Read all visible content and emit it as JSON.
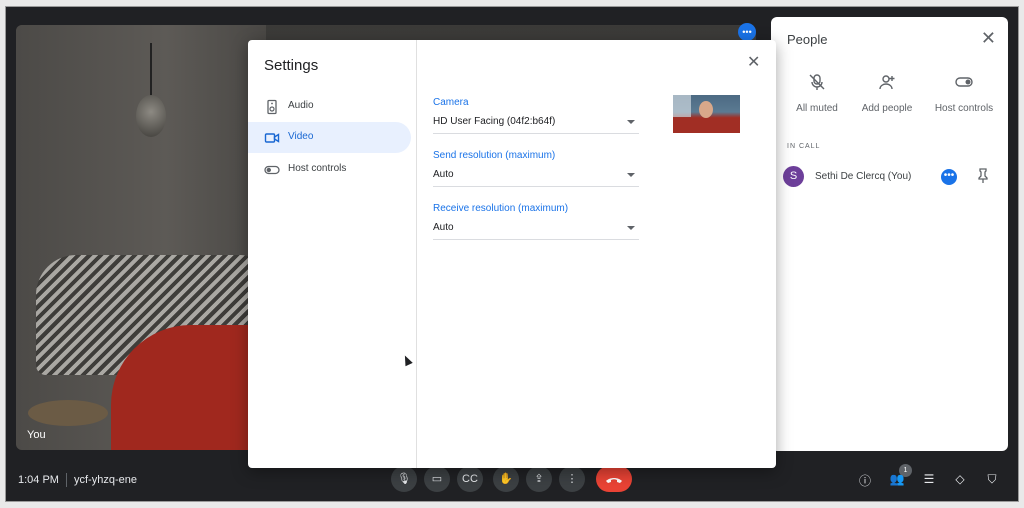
{
  "stage": {
    "self_tag": "You"
  },
  "people_panel": {
    "title": "People",
    "actions": [
      {
        "label": "All muted",
        "icon": "mic-off-icon"
      },
      {
        "label": "Add people",
        "icon": "add-person-icon"
      },
      {
        "label": "Host controls",
        "icon": "toggle-icon"
      }
    ],
    "section_label": "IN CALL",
    "participant": {
      "initial": "S",
      "name": "Sethi De Clercq (You)",
      "avatar_color": "#6d3f9a"
    }
  },
  "bottom_bar": {
    "time": "1:04 PM",
    "meeting_code": "ycf-yhzq-ene",
    "controls": [
      "mic-icon",
      "camera-icon",
      "captions-icon",
      "raise-hand-icon",
      "present-icon",
      "more-options-icon",
      "end-call-icon"
    ],
    "cc_label": "CC",
    "people_count": "1",
    "right_icons": [
      "info-icon",
      "people-icon",
      "chat-icon",
      "activities-icon",
      "shield-icon"
    ],
    "end_call_color": "#ea4335"
  },
  "settings": {
    "title": "Settings",
    "nav": [
      {
        "label": "Audio",
        "icon": "speaker-icon"
      },
      {
        "label": "Video",
        "icon": "video-camera-icon",
        "active": true
      },
      {
        "label": "Host controls",
        "icon": "toggle-icon"
      }
    ],
    "fields": [
      {
        "label": "Camera",
        "value": "HD User Facing (04f2:b64f)"
      },
      {
        "label": "Send resolution (maximum)",
        "value": "Auto"
      },
      {
        "label": "Receive resolution (maximum)",
        "value": "Auto"
      }
    ],
    "accent_color": "#1a73e8"
  }
}
